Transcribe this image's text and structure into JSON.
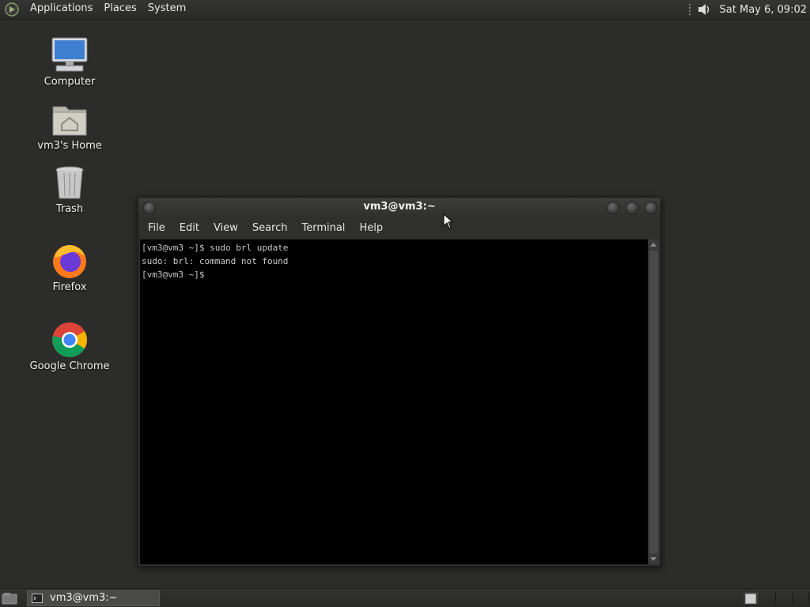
{
  "top_panel": {
    "menus": [
      "Applications",
      "Places",
      "System"
    ],
    "clock": "Sat May  6, 09:02"
  },
  "desktop_icons": [
    {
      "label": "Computer",
      "icon": "computer-icon"
    },
    {
      "label": "vm3's Home",
      "icon": "home-folder-icon"
    },
    {
      "label": "Trash",
      "icon": "trash-icon"
    },
    {
      "label": "Firefox",
      "icon": "firefox-icon"
    },
    {
      "label": "Google Chrome",
      "icon": "chrome-icon"
    }
  ],
  "terminal": {
    "title": "vm3@vm3:~",
    "menus": [
      "File",
      "Edit",
      "View",
      "Search",
      "Terminal",
      "Help"
    ],
    "lines": [
      "[vm3@vm3 ~]$ sudo brl update",
      "sudo: brl: command not found",
      "[vm3@vm3 ~]$ "
    ]
  },
  "taskbar": {
    "task_label": "vm3@vm3:~"
  },
  "colors": {
    "desktop_bg": "#2c2c2b",
    "terminal_bg": "#000000",
    "terminal_fg": "#c8c8c8"
  }
}
